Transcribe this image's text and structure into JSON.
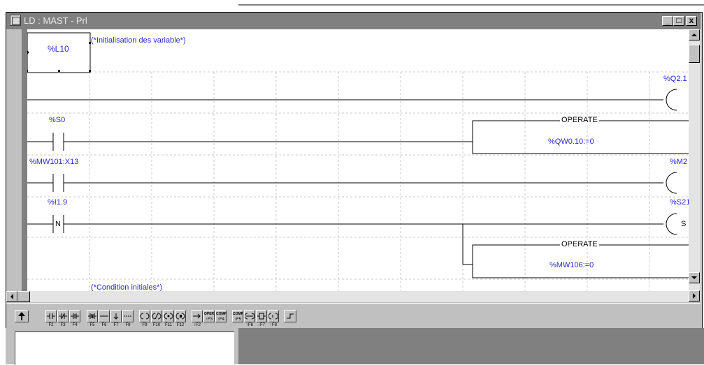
{
  "window": {
    "title": "LD : MAST - Prl",
    "minimize_label": "_",
    "maximize_label": "□",
    "close_label": "x"
  },
  "rung": {
    "label": "%L10",
    "comment": "(*Initialisation des variable*)",
    "next_comment": "(*Condition initiales*)"
  },
  "contacts": [
    {
      "name": "%S0",
      "type": "normally-open"
    },
    {
      "name": "%MW101:X13",
      "type": "normally-open"
    },
    {
      "name": "%I1.9",
      "type": "negative-transition",
      "symbol": "N"
    }
  ],
  "coils": [
    {
      "name": "%Q2.1",
      "type": "coil"
    },
    {
      "name": "%M2",
      "type": "coil"
    },
    {
      "name": "%S21",
      "type": "set-coil",
      "symbol": "S"
    }
  ],
  "operate_blocks": [
    {
      "header": "OPERATE",
      "expression": "%QW0.10:=0"
    },
    {
      "header": "OPERATE",
      "expression": "%MW106:=0"
    }
  ],
  "toolbar": {
    "buttons": [
      {
        "icon": "pointer-arrow-icon",
        "fkey": ""
      },
      {
        "icon": "contact-no-icon",
        "fkey": "F2"
      },
      {
        "icon": "contact-nc-icon",
        "fkey": "F3"
      },
      {
        "icon": "contact-p-icon",
        "fkey": "F4"
      },
      {
        "icon": "contact-n-icon",
        "fkey": "F5"
      },
      {
        "icon": "horizontal-link-icon",
        "fkey": "F6"
      },
      {
        "icon": "vertical-link-icon",
        "fkey": "F7"
      },
      {
        "icon": "fill-link-icon",
        "fkey": "F8"
      },
      {
        "icon": "coil-icon",
        "fkey": "F9"
      },
      {
        "icon": "coil-negated-icon",
        "fkey": "F10"
      },
      {
        "icon": "coil-set-icon",
        "fkey": "F11"
      },
      {
        "icon": "coil-reset-icon",
        "fkey": "F12"
      },
      {
        "icon": "jump-icon",
        "fkey": "↑F2"
      },
      {
        "icon": "operate-block-icon",
        "fkey": "↑F3"
      },
      {
        "icon": "compare-block-icon",
        "fkey": "↑F4"
      },
      {
        "icon": "compare-horizontal-icon",
        "fkey": "↑F5"
      },
      {
        "icon": "call-icon",
        "fkey": "↑F6"
      },
      {
        "icon": "function-block-icon",
        "fkey": "↑F7"
      },
      {
        "icon": "return-icon",
        "fkey": "↑F8"
      },
      {
        "icon": "end-rung-icon",
        "fkey": ""
      }
    ],
    "operate_text": "OPER",
    "compare_text": "COMP"
  },
  "colors": {
    "label_blue": "#2a2ad0",
    "title_gray": "#808080",
    "window_gray": "#c0c0c0"
  }
}
